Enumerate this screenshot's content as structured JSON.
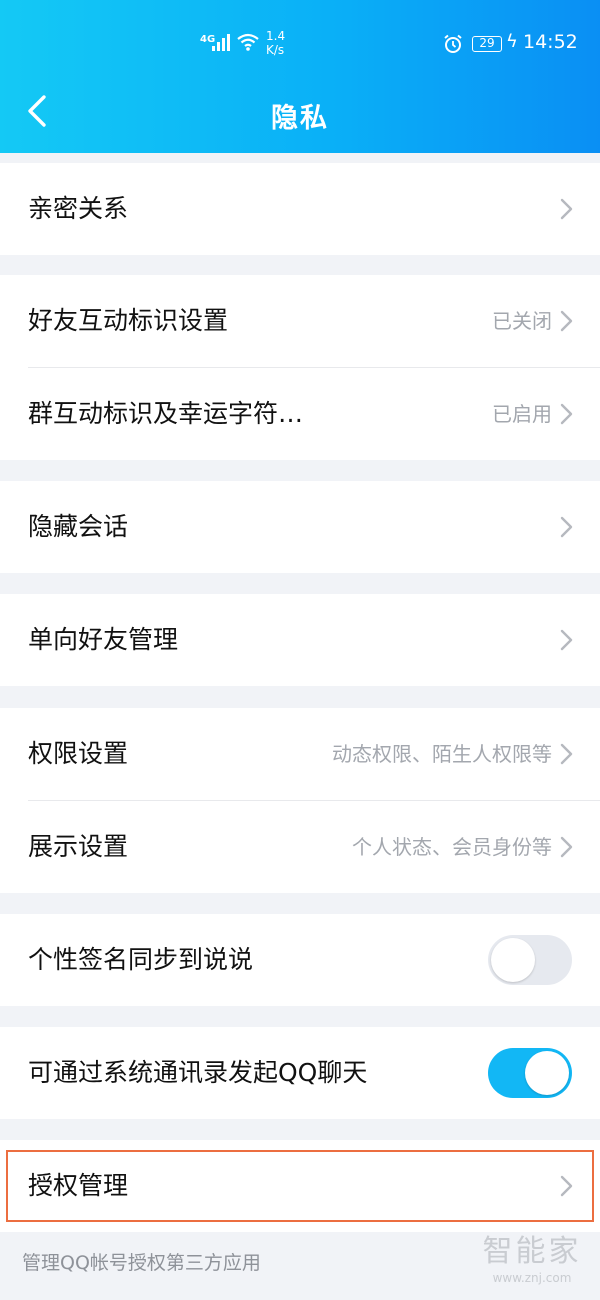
{
  "status_bar": {
    "network": "4G",
    "speed_value": "1.4",
    "speed_unit": "K/s",
    "battery": "29",
    "time": "14:52"
  },
  "header": {
    "title": "隐私"
  },
  "items": [
    {
      "label": "亲密关系",
      "value": ""
    },
    {
      "label": "好友互动标识设置",
      "value": "已关闭"
    },
    {
      "label": "群互动标识及幸运字符…",
      "value": "已启用"
    },
    {
      "label": "隐藏会话",
      "value": ""
    },
    {
      "label": "单向好友管理",
      "value": ""
    },
    {
      "label": "权限设置",
      "value": "动态权限、陌生人权限等"
    },
    {
      "label": "展示设置",
      "value": "个人状态、会员身份等"
    },
    {
      "label": "个性签名同步到说说",
      "toggle": false
    },
    {
      "label": "可通过系统通讯录发起QQ聊天",
      "toggle": true
    },
    {
      "label": "授权管理",
      "value": ""
    }
  ],
  "footer_note": "管理QQ帐号授权第三方应用",
  "watermark": {
    "name": "智能家",
    "site": "www.znj.com"
  },
  "colors": {
    "accent": "#12b7f5",
    "highlight_border": "#ec6e40"
  }
}
